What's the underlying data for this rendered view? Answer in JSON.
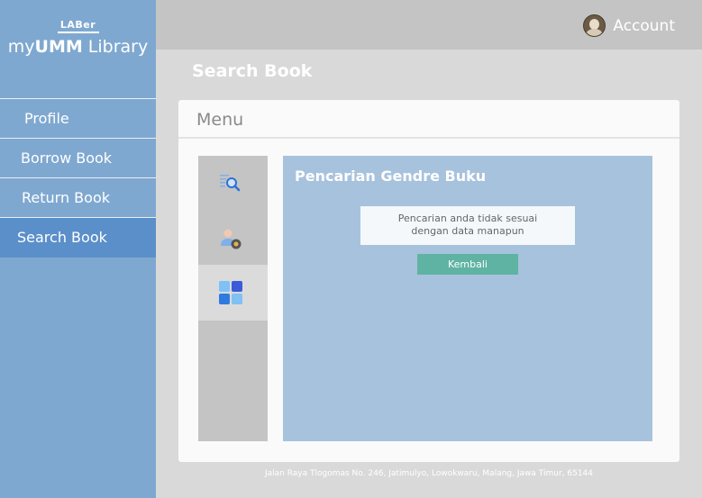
{
  "brand": {
    "mark": "LABer",
    "name_prefix": "my",
    "name_bold": "UMM",
    "name_suffix": " Library"
  },
  "sidebar": {
    "items": [
      {
        "label": "Profile",
        "active": false
      },
      {
        "label": "Borrow Book",
        "active": false
      },
      {
        "label": "Return Book",
        "active": false
      },
      {
        "label": "Search Book",
        "active": true
      }
    ]
  },
  "header": {
    "account_label": "Account",
    "account_icon": "user-avatar"
  },
  "page": {
    "title": "Search Book"
  },
  "menu": {
    "title": "Menu",
    "rail_icons": [
      {
        "name": "search-list-icon",
        "active": false
      },
      {
        "name": "user-settings-icon",
        "active": false
      },
      {
        "name": "category-grid-icon",
        "active": true
      }
    ]
  },
  "panel": {
    "title": "Pencarian Gendre Buku",
    "message_line1": "Pencarian anda tidak sesuai",
    "message_line2": "dengan data manapun",
    "back_label": "Kembali"
  },
  "footer": {
    "address": "Jalan Raya Tlogomas No. 246, Jatimulyo, Lowokwaru, Malang, Jawa Timur, 65144"
  },
  "colors": {
    "sidebar": "#7fa8d0",
    "sidebar_active": "#5b8fca",
    "panel": "#a7c2dd",
    "button": "#5fb3a2"
  }
}
